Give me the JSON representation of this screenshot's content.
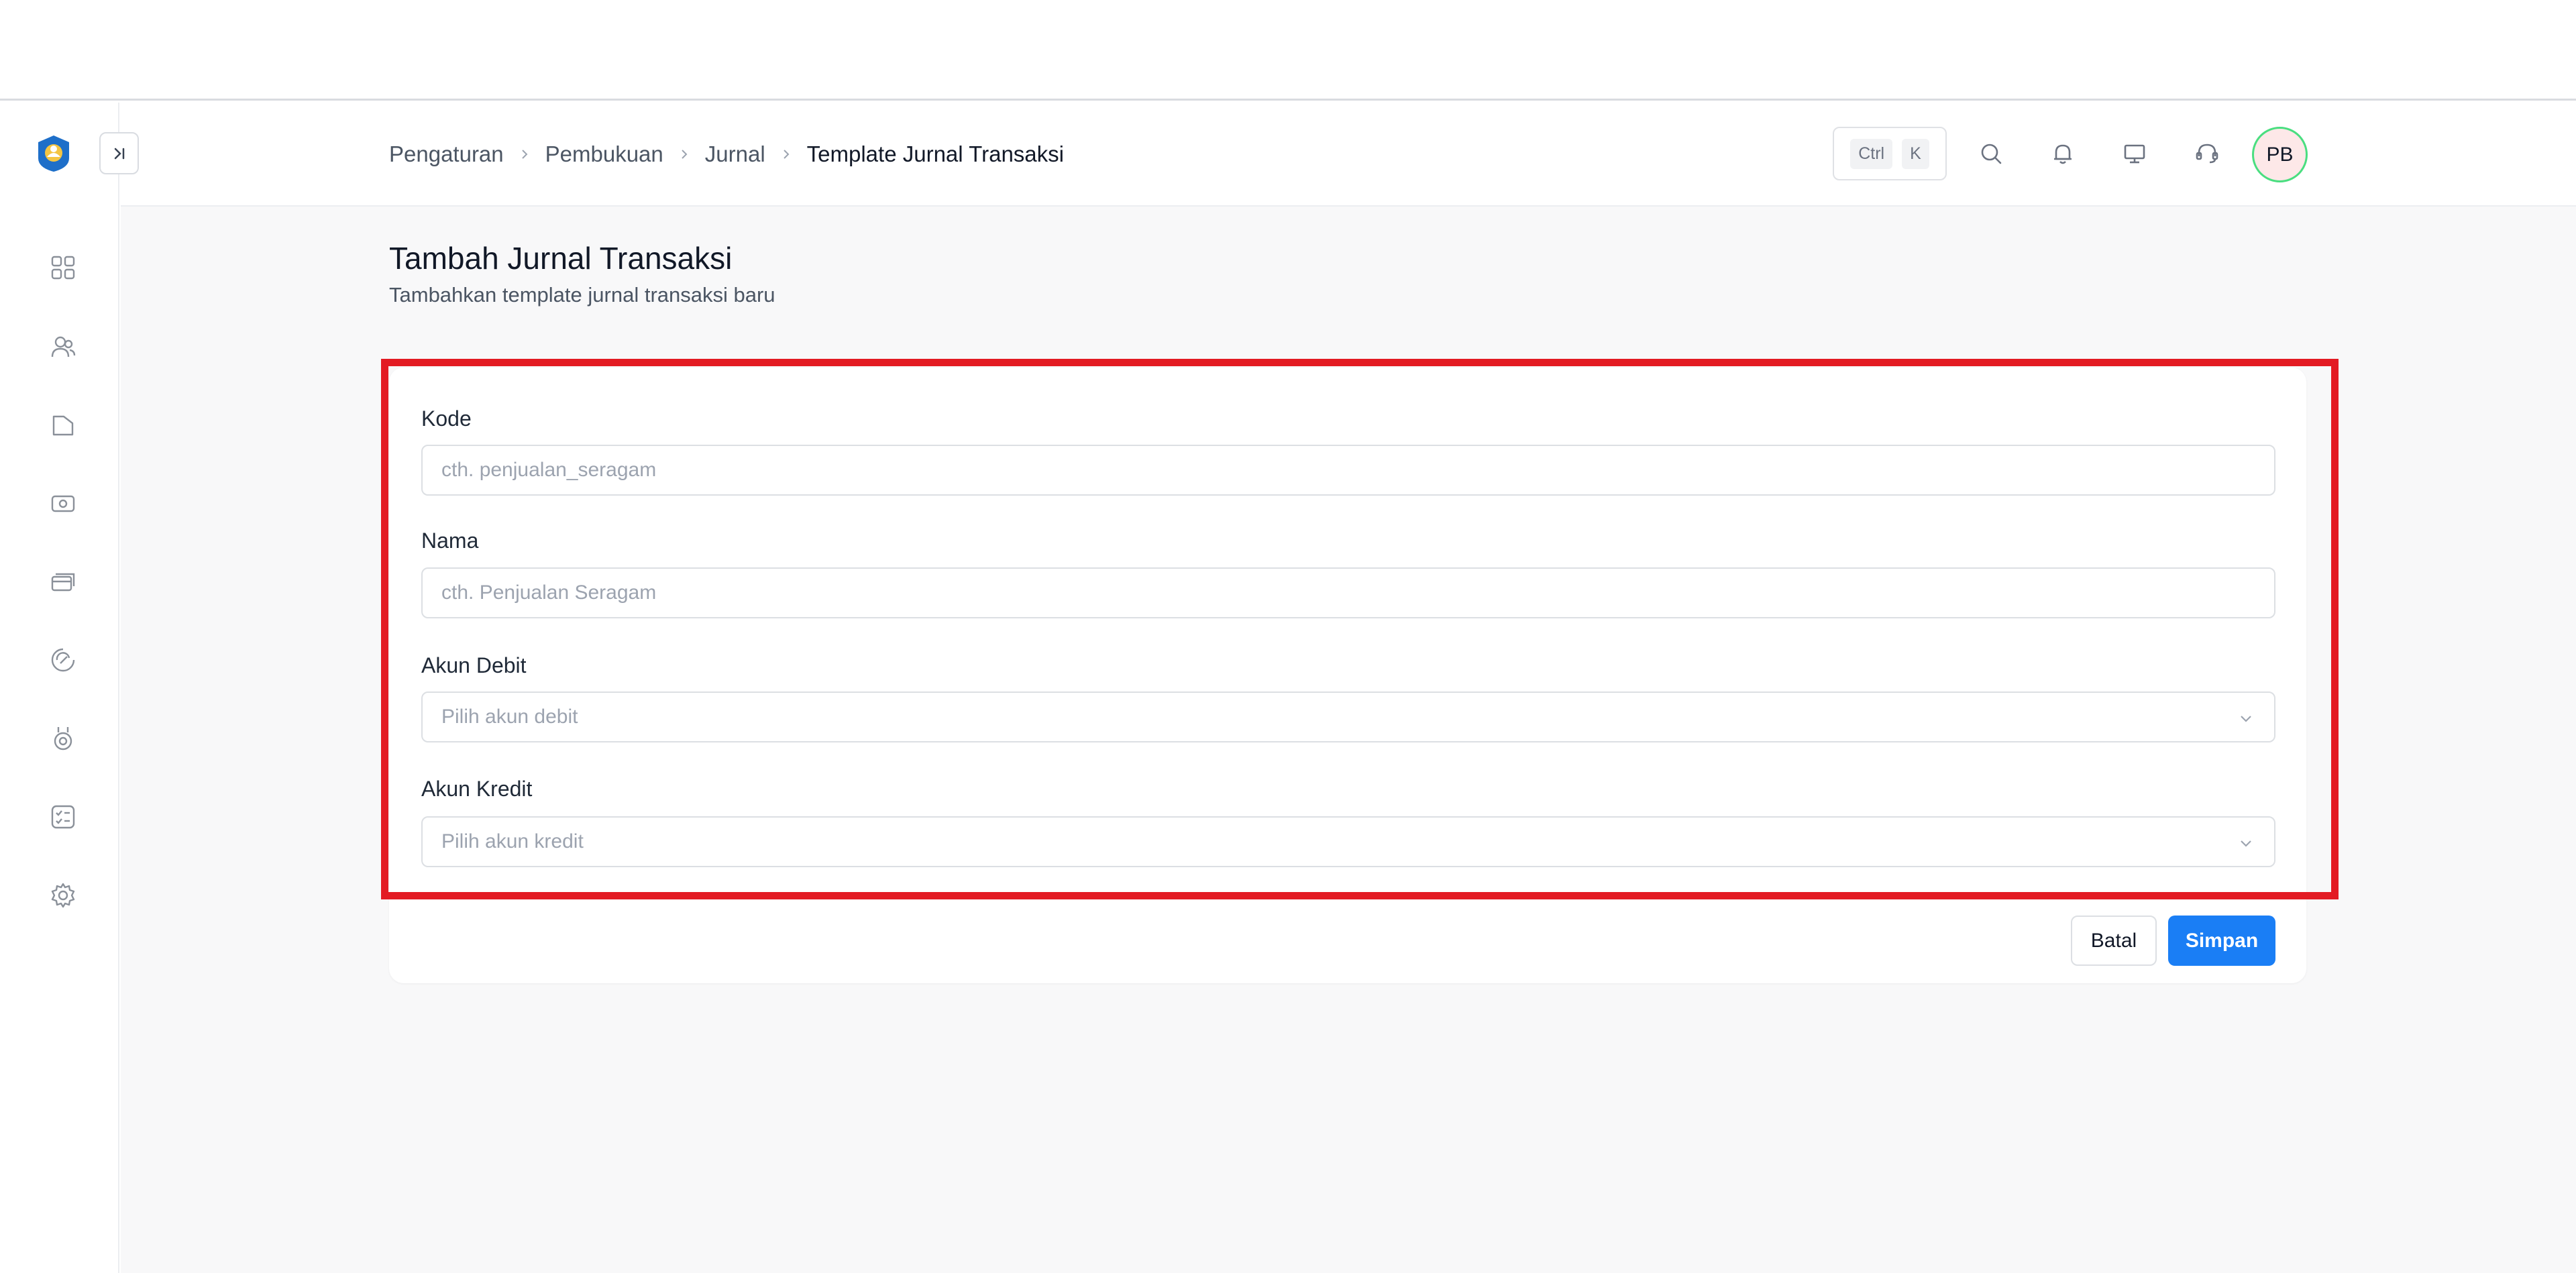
{
  "breadcrumb": {
    "items": [
      "Pengaturan",
      "Pembukuan",
      "Jurnal",
      "Template Jurnal Transaksi"
    ]
  },
  "shortcut": {
    "key1": "Ctrl",
    "key2": "K"
  },
  "user": {
    "initials": "PB"
  },
  "page": {
    "title": "Tambah Jurnal Transaksi",
    "subtitle": "Tambahkan template jurnal transaksi baru"
  },
  "form": {
    "kode": {
      "label": "Kode",
      "placeholder": "cth. penjualan_seragam"
    },
    "nama": {
      "label": "Nama",
      "placeholder": "cth. Penjualan Seragam"
    },
    "akun_debit": {
      "label": "Akun Debit",
      "placeholder": "Pilih akun debit"
    },
    "akun_kredit": {
      "label": "Akun Kredit",
      "placeholder": "Pilih akun kredit"
    }
  },
  "actions": {
    "cancel_label": "Batal",
    "save_label": "Simpan"
  },
  "colors": {
    "primary": "#1a7ef5",
    "highlight": "#e31b23",
    "avatar_ring": "#4ade80"
  },
  "sidebar": {
    "icons": [
      "dashboard-icon",
      "users-icon",
      "folder-icon",
      "money-icon",
      "cards-icon",
      "discount-icon",
      "medal-icon",
      "checklist-icon",
      "settings-icon"
    ]
  }
}
